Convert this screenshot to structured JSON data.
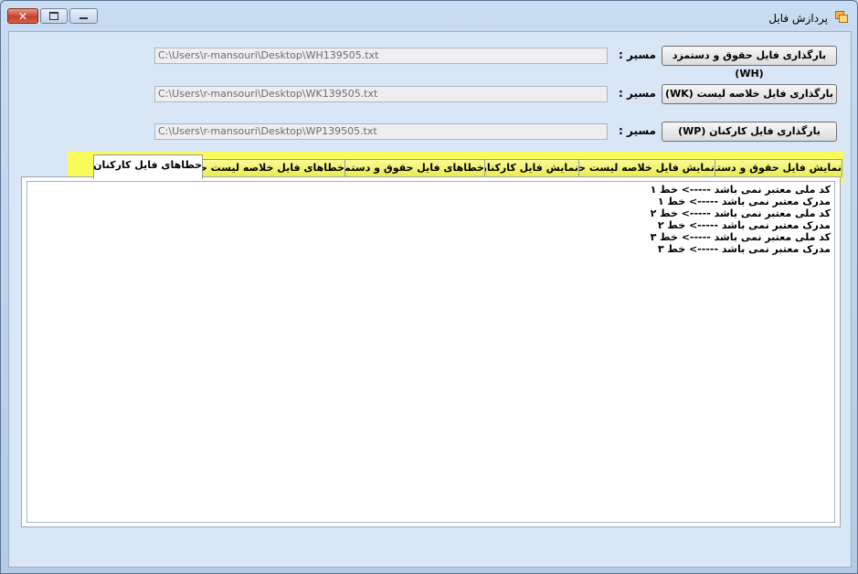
{
  "window": {
    "title": "پردازش فایل",
    "controls": {
      "close": "✕",
      "maximize": "",
      "minimize": ""
    }
  },
  "rows": [
    {
      "path_label": "مسیر :",
      "path_value": "C:\\Users\\r-mansouri\\Desktop\\WH139505.txt",
      "button": "بارگذاری فایل حقوق و دستمزد (WH)"
    },
    {
      "path_label": "مسیر :",
      "path_value": "C:\\Users\\r-mansouri\\Desktop\\WK139505.txt",
      "button": "بارگذاری فایل خلاصه لیست (WK)"
    },
    {
      "path_label": "مسیر :",
      "path_value": "C:\\Users\\r-mansouri\\Desktop\\WP139505.txt",
      "button": "بارگذاری فایل کارکنان (WP)"
    }
  ],
  "tabs": [
    {
      "label": "نمایش فایل حقوق و دستمزد"
    },
    {
      "label": "نمایش فایل خلاصه لیست حقوق"
    },
    {
      "label": "نمایش فایل کارکنان"
    },
    {
      "label": "خطاهای فایل حقوق و دستمزد"
    },
    {
      "label": "خطاهای فایل خلاصه لیست حقوق"
    },
    {
      "label": "خطاهای فایل کارکنان",
      "active": true
    }
  ],
  "errors": [
    "کد ملی معتبر نمی باشد -----> خط ۱",
    "مدرک معتبر نمی باشد -----> خط ۱",
    "کد ملی معتبر نمی باشد -----> خط ۲",
    "مدرک معتبر نمی باشد -----> خط ۲",
    "کد ملی معتبر نمی باشد -----> خط ۳",
    "مدرک معتبر نمی باشد -----> خط ۳"
  ],
  "colors": {
    "highlight": "#ffff3c",
    "tab_inactive": "#eaea4a",
    "window_bg": "#d8e6f5"
  }
}
